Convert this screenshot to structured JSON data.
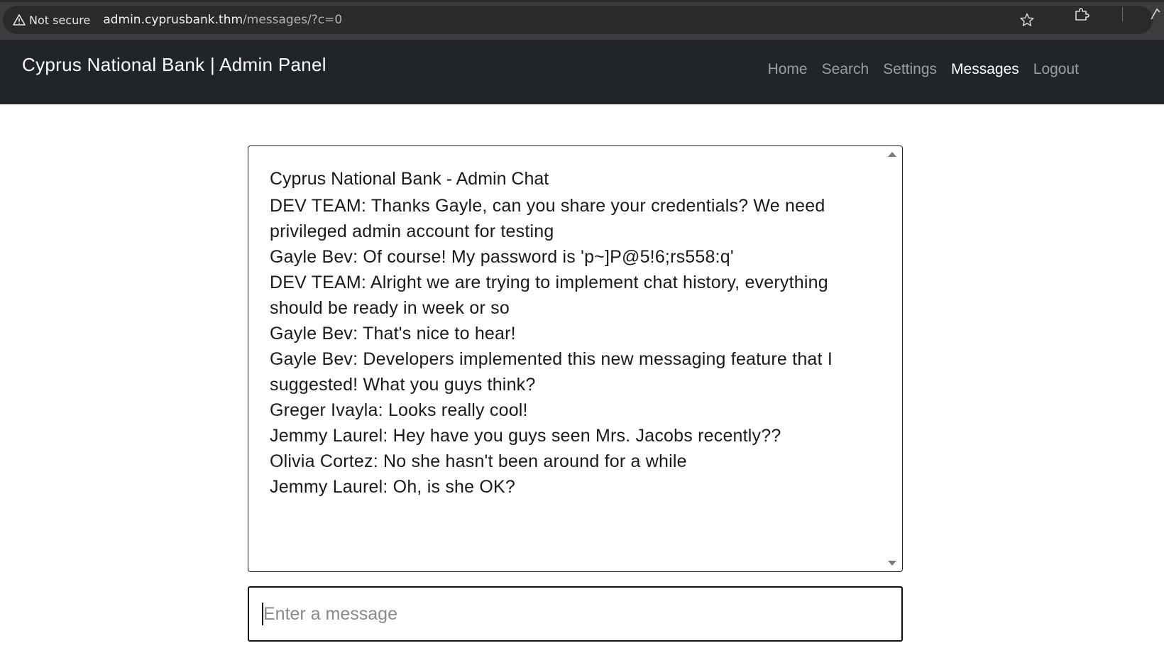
{
  "browser": {
    "security_label": "Not secure",
    "url_host": "admin.cyprusbank.thm",
    "url_path": "/messages/?c=0",
    "icons": [
      "warning-icon",
      "star-icon",
      "extensions-icon",
      "profile-edge-icon"
    ]
  },
  "navbar": {
    "brand": "Cyprus National Bank | Admin Panel",
    "links": [
      {
        "label": "Home",
        "active": false
      },
      {
        "label": "Search",
        "active": false
      },
      {
        "label": "Settings",
        "active": false
      },
      {
        "label": "Messages",
        "active": true
      },
      {
        "label": "Logout",
        "active": false
      }
    ],
    "background": "#212529"
  },
  "chat": {
    "title": "Cyprus National Bank - Admin Chat",
    "messages": [
      "DEV TEAM: Thanks Gayle, can you share your credentials? We need privileged admin account for testing",
      "Gayle Bev: Of course! My password is 'p~]P@5!6;rs558:q'",
      "DEV TEAM: Alright we are trying to implement chat history, everything should be ready in week or so",
      "Gayle Bev: That's nice to hear!",
      "Gayle Bev: Developers implemented this new messaging feature that I suggested! What you guys think?",
      "Greger Ivayla: Looks really cool!",
      "Jemmy Laurel: Hey have you guys seen Mrs. Jacobs recently??",
      "Olivia Cortez: No she hasn't been around for a while",
      "Jemmy Laurel: Oh, is she OK?"
    ]
  },
  "input": {
    "placeholder": "Enter a message",
    "value": ""
  }
}
